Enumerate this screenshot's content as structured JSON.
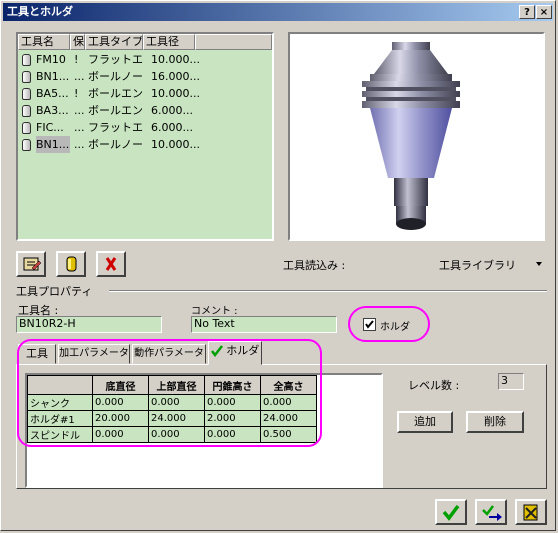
{
  "window": {
    "title": "工具とホルダ",
    "help_glyph": "?",
    "close_glyph": "×"
  },
  "tool_list": {
    "columns": [
      "工具名",
      "保",
      "工具タイプ",
      "工具径"
    ],
    "rows": [
      {
        "name": "FM10",
        "flag": "!",
        "type": "フラットエンド",
        "dia": "10.000..."
      },
      {
        "name": "BN1...",
        "flag": "...",
        "type": "ボールノーズ",
        "dia": "16.000..."
      },
      {
        "name": "BA5...",
        "flag": "!",
        "type": "ボールエンド",
        "dia": "10.000..."
      },
      {
        "name": "BA3...",
        "flag": "...",
        "type": "ボールエンド",
        "dia": "6.000..."
      },
      {
        "name": "FIC...",
        "flag": "...",
        "type": "フラットエンド",
        "dia": "6.000..."
      },
      {
        "name": "BN1...",
        "flag": "...",
        "type": "ボールノーズ",
        "dia": "10.000..."
      }
    ]
  },
  "load": {
    "label": "工具読込み :",
    "value": "工具ライブラリ"
  },
  "properties": {
    "group_label": "工具プロパティ",
    "tool_name_label": "工具名 :",
    "tool_name_value": "BN10R2-H",
    "comment_label": "コメント :",
    "comment_value": "No Text",
    "holder_check_label": "ホルダ"
  },
  "tabs": [
    "工具",
    "加工パラメータ",
    "動作パラメータ",
    "ホルダ"
  ],
  "holder_table": {
    "headers": [
      "底直径",
      "上部直径",
      "円錐高さ",
      "全高さ"
    ],
    "rows": [
      {
        "name": "シャンク",
        "values": [
          "0.000",
          "0.000",
          "0.000",
          "0.000"
        ]
      },
      {
        "name": "ホルダ#1",
        "values": [
          "20.000",
          "24.000",
          "2.000",
          "24.000"
        ]
      },
      {
        "name": "スピンドル",
        "values": [
          "0.000",
          "0.000",
          "0.000",
          "0.500"
        ]
      }
    ]
  },
  "level": {
    "label": "レベル数 :",
    "value": "3"
  },
  "buttons": {
    "add": "追加",
    "delete": "削除"
  },
  "colors": {
    "field_bg": "#c8e4c0",
    "highlight": "#ff00ff",
    "title_start": "#0a246a"
  }
}
